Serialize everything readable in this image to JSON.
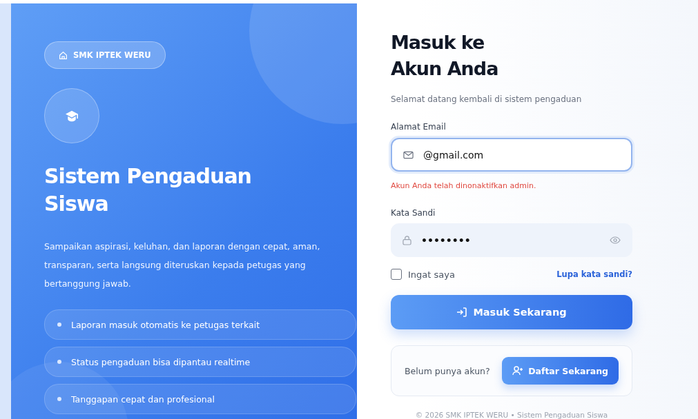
{
  "hero": {
    "school_badge": "SMK IPTEK WERU",
    "title": "Sistem Pengaduan Siswa",
    "description": "Sampaikan aspirasi, keluhan, dan laporan dengan cepat, aman, transparan, serta langsung diteruskan kepada petugas yang bertanggung jawab.",
    "features": [
      "Laporan masuk otomatis ke petugas terkait",
      "Status pengaduan bisa dipantau realtime",
      "Tanggapan cepat dan profesional"
    ]
  },
  "login": {
    "title_line_1": "Masuk ke",
    "title_line_2": "Akun Anda",
    "subtitle": "Selamat datang kembali di sistem pengaduan",
    "email": {
      "label": "Alamat Email",
      "value": "@gmail.com",
      "focused": true,
      "error": "Akun Anda telah dinonaktifkan admin."
    },
    "password": {
      "label": "Kata Sandi",
      "value": "••••••••"
    },
    "remember": {
      "label": "Ingat saya",
      "checked": false
    },
    "forgot_link": "Lupa kata sandi?",
    "submit_button": "Masuk Sekarang",
    "register": {
      "prompt": "Belum punya akun?",
      "button": "Daftar Sekarang"
    },
    "footer": "© 2026 SMK IPTEK WERU • Sistem Pengaduan Siswa"
  }
}
